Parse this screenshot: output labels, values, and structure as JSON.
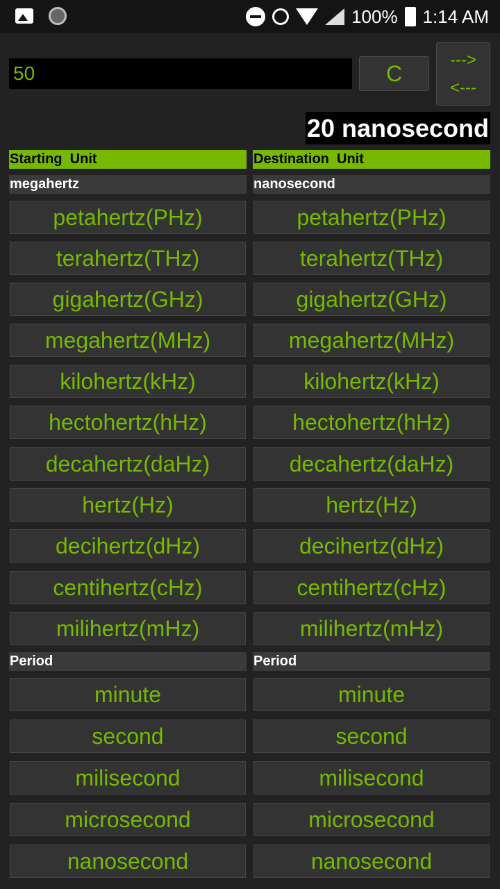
{
  "status_bar": {
    "battery": "100%",
    "time": "1:14 AM"
  },
  "converter": {
    "input_value": "50",
    "clear_label": "C",
    "swap_forward": "--->",
    "swap_back": "<---",
    "result": "20 nanosecond"
  },
  "starting": {
    "header": "Starting  Unit",
    "current": "megahertz",
    "frequency_units": [
      "petahertz(PHz)",
      "terahertz(THz)",
      "gigahertz(GHz)",
      "megahertz(MHz)",
      "kilohertz(kHz)",
      "hectohertz(hHz)",
      "decahertz(daHz)",
      "hertz(Hz)",
      "decihertz(dHz)",
      "centihertz(cHz)",
      "milihertz(mHz)"
    ],
    "period_label": "Period",
    "period_units": [
      "minute",
      "second",
      "milisecond",
      "microsecond",
      "nanosecond"
    ]
  },
  "destination": {
    "header": "Destination  Unit",
    "current": "nanosecond",
    "frequency_units": [
      "petahertz(PHz)",
      "terahertz(THz)",
      "gigahertz(GHz)",
      "megahertz(MHz)",
      "kilohertz(kHz)",
      "hectohertz(hHz)",
      "decahertz(daHz)",
      "hertz(Hz)",
      "decihertz(dHz)",
      "centihertz(cHz)",
      "milihertz(mHz)"
    ],
    "period_label": "Period",
    "period_units": [
      "minute",
      "second",
      "milisecond",
      "microsecond",
      "nanosecond"
    ]
  },
  "colors": {
    "accent": "#76b900",
    "background": "#222222",
    "button": "#333333"
  }
}
